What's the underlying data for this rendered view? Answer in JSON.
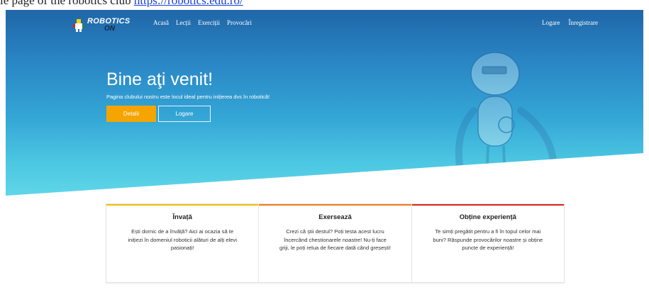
{
  "caption": {
    "text": "le page of the robotics club",
    "link_text": "https://robotics.edu.ro/"
  },
  "nav": {
    "logo_main": "ROBOTICS",
    "logo_sub": "ON",
    "links": [
      "Acasă",
      "Lecții",
      "Exerciții",
      "Provocări"
    ],
    "right": [
      "Logare",
      "Înregistrare"
    ]
  },
  "hero": {
    "title": "Bine aţi venit!",
    "subtitle": "Pagina clubului nostru este locul ideal pentru inițierea dvs în robotică!",
    "details_button": "Detalii",
    "login_button": "Logare"
  },
  "cards": [
    {
      "title": "Învață",
      "text": "Ești dornic de a învăță? Aici ai ocazia să te inițiezi în domeniul roboticii alături de alți elevi pasionați!",
      "accent": "#f2c200"
    },
    {
      "title": "Exersează",
      "text": "Crezi că știi destul? Poți testa acest lucru încercând chestionarele noastre! Nu-ți face griji, le poți relua de fiecare dată când greșești!",
      "accent": "#f07a1a"
    },
    {
      "title": "Obține experiență",
      "text": "Te simți pregătit pentru a fi în topul celor mai buni? Răspunde provocărilor noastre și obține puncte de experiență!",
      "accent": "#d8261c"
    }
  ],
  "colors": {
    "brand_orange": "#f5a400",
    "hero_top": "#1f66a8",
    "hero_bottom": "#5fd6e8"
  },
  "icons": [
    "robot-logo-icon",
    "robot-illustration"
  ]
}
